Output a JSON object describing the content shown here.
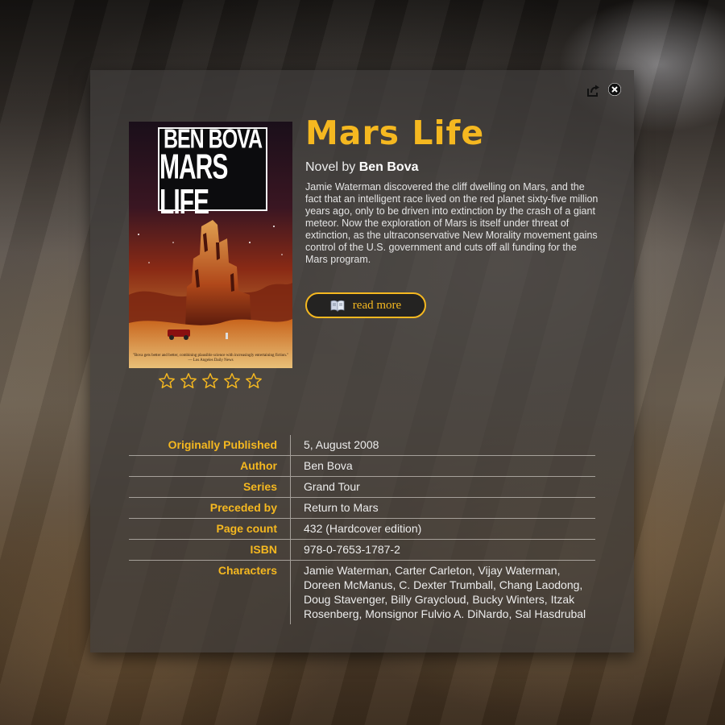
{
  "book": {
    "title": "Mars Life",
    "kind": "Novel by",
    "author": "Ben Bova",
    "description": "Jamie Waterman discovered the cliff dwelling on Mars, and the fact that an intelligent race lived on the red planet sixty-five million years ago, only to be driven into extinction by the crash of a giant meteor. Now the exploration of Mars is itself under threat of extinction, as the ultraconservative New Morality movement gains control of the U.S. government and cuts off all funding for the Mars program.",
    "rating": {
      "filled": 0,
      "max": 5
    }
  },
  "cover": {
    "author_text": "BEN BOVA",
    "title_text": "MARS LIFE",
    "quote": "\"Bova gets better and better, combining plausible science with increasingly entertaining fiction.\"",
    "quote_source": "— Los Angeles Daily News"
  },
  "actions": {
    "read_more_label": "read more",
    "share_icon": "share-icon",
    "close_icon": "close-icon"
  },
  "details": [
    {
      "label": "Originally Published",
      "value": "5, August 2008"
    },
    {
      "label": "Author",
      "value": "Ben Bova"
    },
    {
      "label": "Series",
      "value": "Grand Tour"
    },
    {
      "label": "Preceded by",
      "value": "Return to Mars"
    },
    {
      "label": "Page count",
      "value": "432 (Hardcover edition)"
    },
    {
      "label": "ISBN",
      "value": "978-0-7653-1787-2"
    },
    {
      "label": "Characters",
      "value": "Jamie Waterman, Carter Carleton, Vijay Waterman, Doreen McManus, C. Dexter Trumball, Chang Laodong, Doug Stavenger, Billy Graycloud, Bucky Winters, Itzak Rosenberg, Monsignor Fulvio A. DiNardo, Sal Hasdrubal"
    }
  ],
  "colors": {
    "accent": "#f5b820",
    "panel": "#3e3c3a",
    "text": "#ececec"
  }
}
